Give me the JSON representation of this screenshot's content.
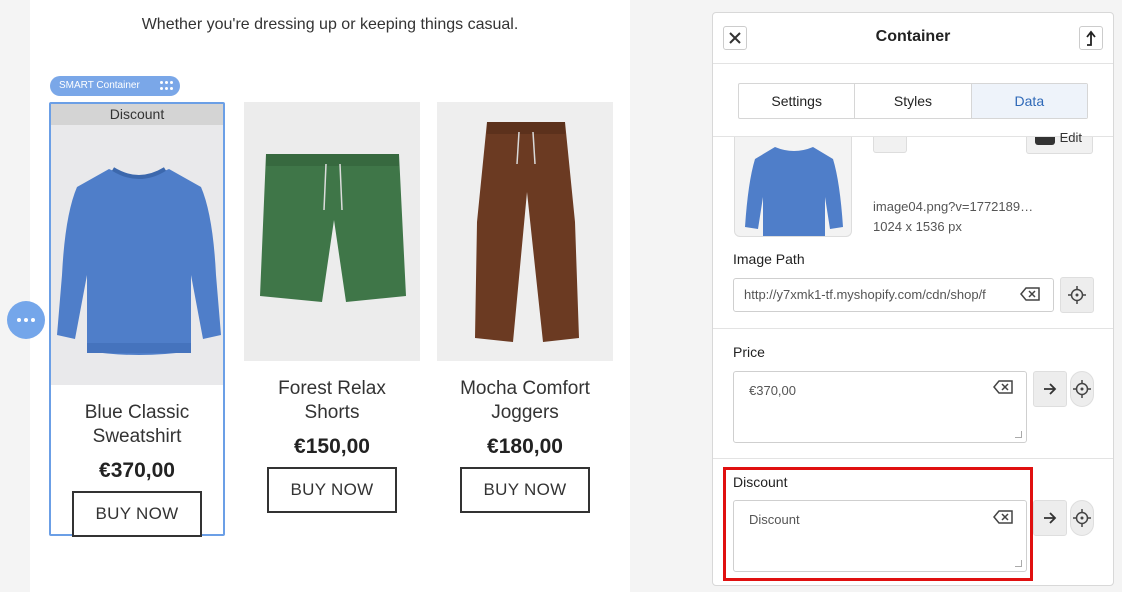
{
  "canvas": {
    "tagline": "Whether you're dressing up or keeping things casual.",
    "smart_badge": "SMART Container",
    "products": [
      {
        "discount": "Discount",
        "name": "Blue Classic Sweatshirt",
        "price": "€370,00",
        "button": "BUY NOW",
        "color": "#4f7ec9",
        "selected": true
      },
      {
        "name": "Forest Relax Shorts",
        "price": "€150,00",
        "button": "BUY NOW",
        "color": "#3f7648"
      },
      {
        "name": "Mocha Comfort Joggers",
        "price": "€180,00",
        "button": "BUY NOW",
        "color": "#6b3a22"
      }
    ]
  },
  "panel": {
    "title": "Container",
    "tabs": [
      "Settings",
      "Styles",
      "Data"
    ],
    "active_tab": "Data",
    "image": {
      "edit_label": "Edit",
      "file_name": "image04.png?v=1772189…",
      "dimensions": "1024 x 1536 px"
    },
    "image_path": {
      "label": "Image Path",
      "value": "http://y7xmk1-tf.myshopify.com/cdn/shop/f"
    },
    "price": {
      "label": "Price",
      "value": "€370,00"
    },
    "discount": {
      "label": "Discount",
      "value": "Discount"
    }
  },
  "colors": {
    "accent": "#6b9fe6",
    "highlight": "#e01010",
    "active_tab": "#2f69b8"
  }
}
